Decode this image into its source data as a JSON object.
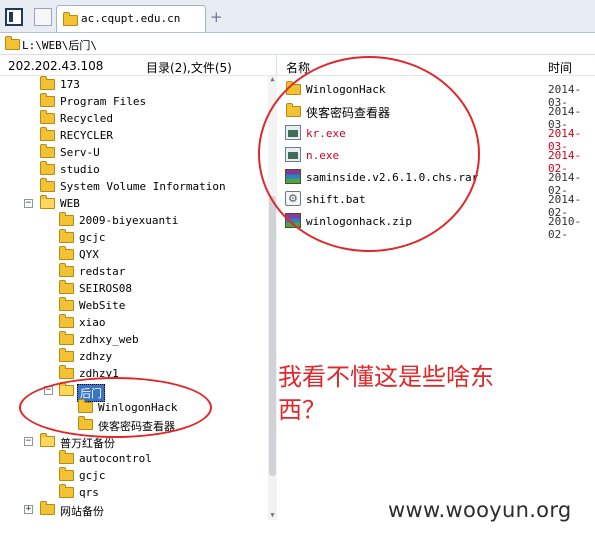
{
  "tabs": {
    "active_label": "ac.cqupt.edu.cn",
    "new_tab": "+"
  },
  "address": {
    "path": "L:\\WEB\\后门\\"
  },
  "header": {
    "ip": "202.202.43.108",
    "counts": "目录(2),文件(5)",
    "col_name": "名称",
    "col_time": "时间"
  },
  "tree": {
    "items": [
      {
        "label": "173"
      },
      {
        "label": "Program Files"
      },
      {
        "label": "Recycled"
      },
      {
        "label": "RECYCLER"
      },
      {
        "label": "Serv-U"
      },
      {
        "label": "studio"
      },
      {
        "label": "System Volume Information"
      },
      {
        "label": "WEB"
      },
      {
        "label": "2009-biyexuanti"
      },
      {
        "label": "gcjc"
      },
      {
        "label": "QYX"
      },
      {
        "label": "redstar"
      },
      {
        "label": "SEIROS08"
      },
      {
        "label": "WebSite"
      },
      {
        "label": "xiao"
      },
      {
        "label": "zdhxy_web"
      },
      {
        "label": "zdhzy"
      },
      {
        "label": "zdhzy1"
      },
      {
        "label": "后门"
      },
      {
        "label": "WinlogonHack"
      },
      {
        "label": "侠客密码查看器"
      },
      {
        "label": "普万红备份"
      },
      {
        "label": "autocontrol"
      },
      {
        "label": "gcjc"
      },
      {
        "label": "qrs"
      },
      {
        "label": "网站备份"
      }
    ],
    "expanders": {
      "minus": "−",
      "plus": "+"
    }
  },
  "files": [
    {
      "name": "WinlogonHack",
      "time": "2014-03-",
      "icon": "folder-icon"
    },
    {
      "name": "侠客密码查看器",
      "time": "2014-03-",
      "icon": "folder-icon"
    },
    {
      "name": "kr.exe",
      "time": "2014-03-",
      "icon": "exe-icon",
      "highlight": "#d0021b"
    },
    {
      "name": "n.exe",
      "time": "2014-02-",
      "icon": "exe-icon",
      "highlight": "#d0021b"
    },
    {
      "name": "saminside.v2.6.1.0.chs.rar",
      "time": "2014-02-",
      "icon": "rar-icon"
    },
    {
      "name": "shift.bat",
      "time": "2014-02-",
      "icon": "bat-icon"
    },
    {
      "name": "winlogonhack.zip",
      "time": "2010-02-",
      "icon": "zip-icon"
    }
  ],
  "annotation": {
    "text_line1": "我看不懂这是些啥东",
    "text_line2": "西？",
    "color": "#e0282a"
  },
  "watermark": "www.wooyun.org"
}
